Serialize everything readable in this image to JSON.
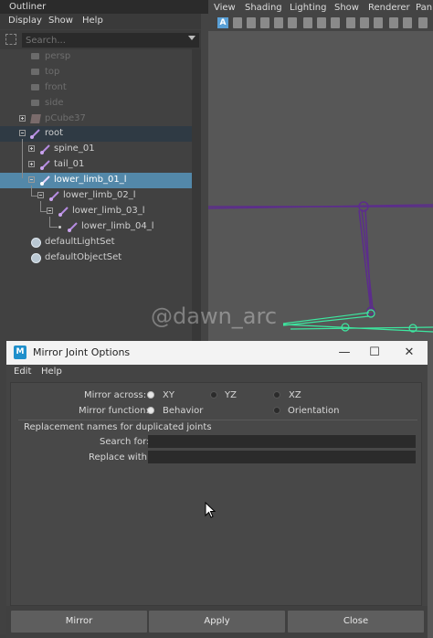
{
  "outliner": {
    "title": "Outliner",
    "menu": [
      "Display",
      "Show",
      "Help"
    ],
    "search_placeholder": "Search...",
    "items": [
      {
        "label": "persp"
      },
      {
        "label": "top"
      },
      {
        "label": "front"
      },
      {
        "label": "side"
      },
      {
        "label": "pCube37"
      },
      {
        "label": "root"
      },
      {
        "label": "spine_01"
      },
      {
        "label": "tail_01"
      },
      {
        "label": "lower_limb_01_l"
      },
      {
        "label": "lower_limb_02_l"
      },
      {
        "label": "lower_limb_03_l"
      },
      {
        "label": "lower_limb_04_l"
      },
      {
        "label": "defaultLightSet"
      },
      {
        "label": "defaultObjectSet"
      }
    ]
  },
  "viewport": {
    "menu": [
      "View",
      "Shading",
      "Lighting",
      "Show",
      "Renderer",
      "Pan"
    ],
    "toolbar_first": "A",
    "joint_color": "#5c2d8c",
    "selected_joint_color": "#3de8a0"
  },
  "watermark": "@dawn_arc",
  "dialog": {
    "title": "Mirror Joint Options",
    "app_icon_letter": "M",
    "controls": {
      "minimize": "—",
      "maximize": "☐",
      "close": "✕"
    },
    "menu": [
      "Edit",
      "Help"
    ],
    "mirror_across_label": "Mirror across:",
    "mirror_across_options": [
      "XY",
      "YZ",
      "XZ"
    ],
    "mirror_across_selected": "XY",
    "mirror_function_label": "Mirror function:",
    "mirror_function_options": [
      "Behavior",
      "Orientation"
    ],
    "mirror_function_selected": "Behavior",
    "replacement_header": "Replacement names for duplicated joints",
    "search_for_label": "Search for:",
    "search_for_value": "",
    "replace_with_label": "Replace with:",
    "replace_with_value": "",
    "buttons": {
      "mirror": "Mirror",
      "apply": "Apply",
      "close": "Close"
    }
  }
}
